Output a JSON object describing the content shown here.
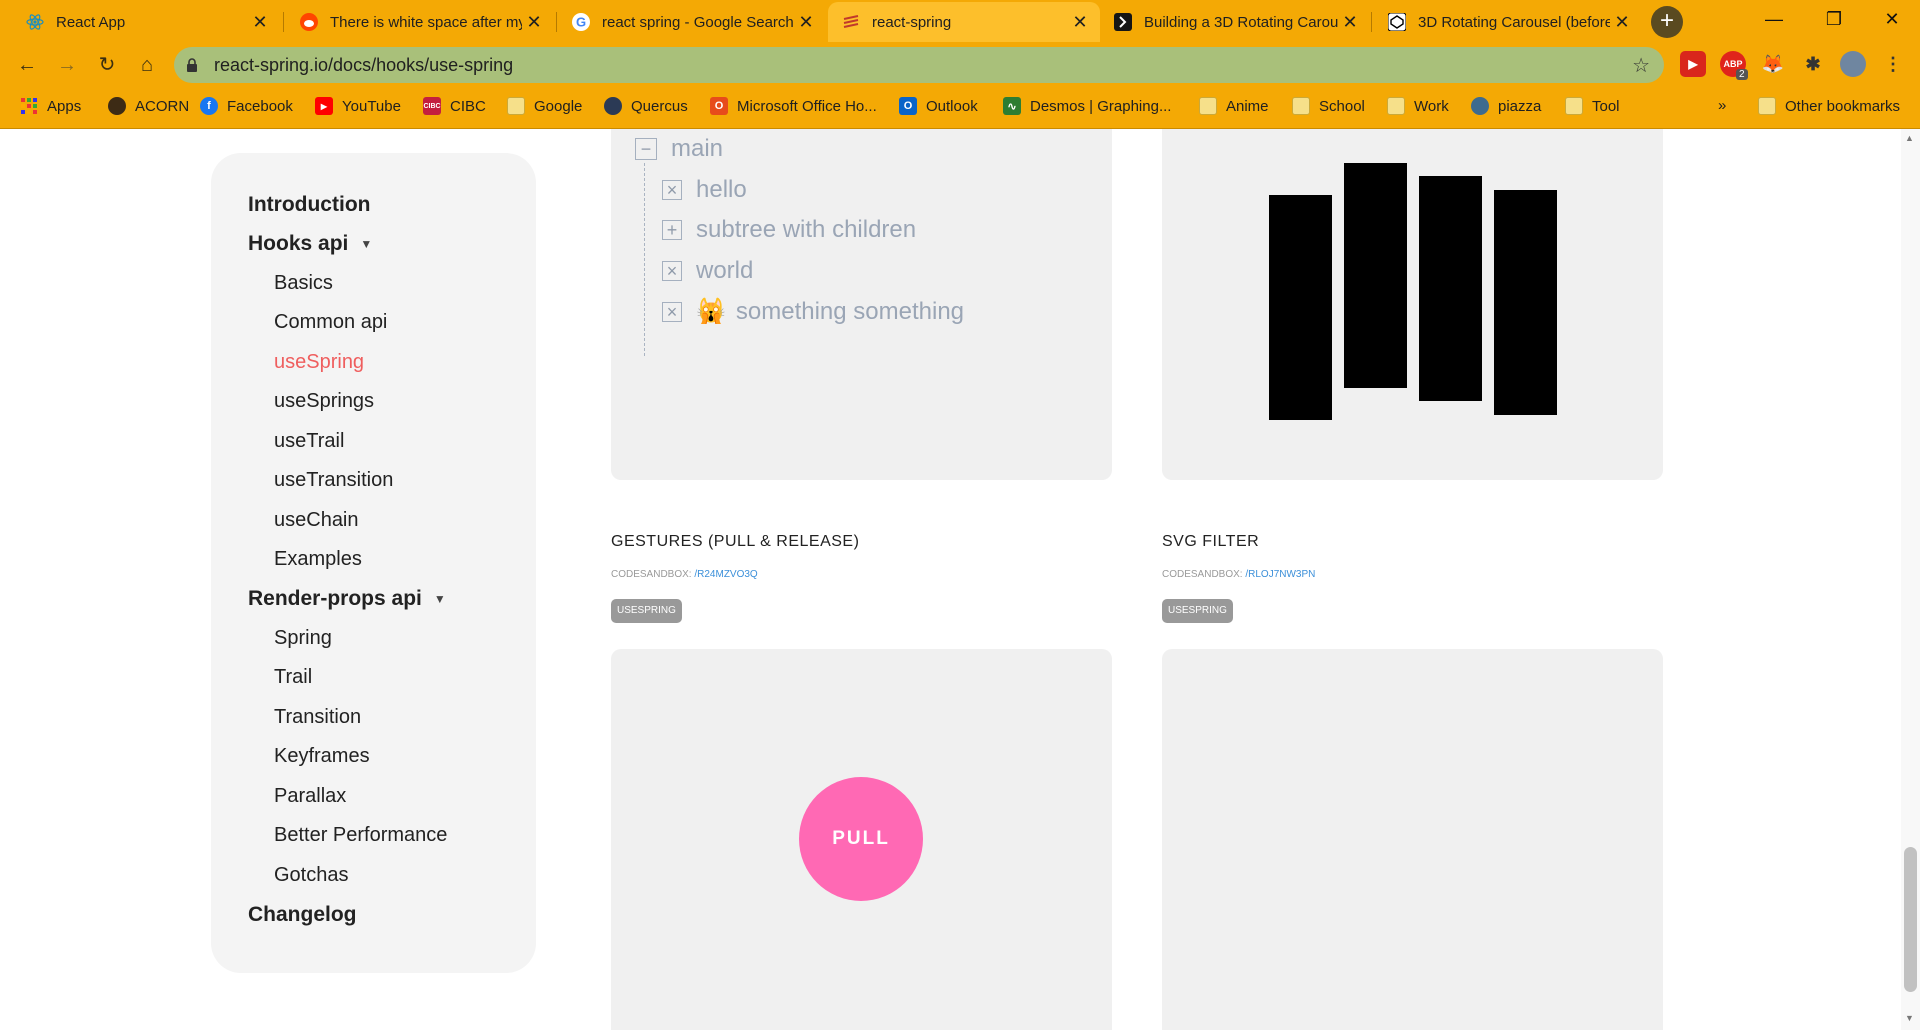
{
  "tabs": [
    {
      "title": "React App",
      "icon": "react-icon",
      "color": "#61dafb"
    },
    {
      "title": "There is white space after my",
      "icon": "reddit-icon",
      "color": "#ff4500"
    },
    {
      "title": "react spring - Google Search",
      "icon": "google-icon",
      "color": "#4285f4"
    },
    {
      "title": "react-spring",
      "icon": "react-spring-icon",
      "color": "#ef5e5e"
    },
    {
      "title": "Building a 3D Rotating Carou",
      "icon": "codesandbox-icon",
      "color": "#000000"
    },
    {
      "title": "3D Rotating Carousel (before",
      "icon": "codepen-icon",
      "color": "#000000"
    }
  ],
  "active_tab_index": 3,
  "address_bar": {
    "url": "react-spring.io/docs/hooks/use-spring"
  },
  "extensions": {
    "abp_badge": "2"
  },
  "bookmarks": [
    {
      "label": "Apps",
      "icon": "apps-grid-icon"
    },
    {
      "label": "ACORN",
      "icon": "acorn-icon"
    },
    {
      "label": "Facebook",
      "icon": "facebook-icon"
    },
    {
      "label": "YouTube",
      "icon": "youtube-icon"
    },
    {
      "label": "CIBC",
      "icon": "cibc-icon"
    },
    {
      "label": "Google",
      "icon": "folder-icon"
    },
    {
      "label": "Quercus",
      "icon": "quercus-icon"
    },
    {
      "label": "Microsoft Office Ho...",
      "icon": "office-icon"
    },
    {
      "label": "Outlook",
      "icon": "outlook-icon"
    },
    {
      "label": "Desmos | Graphing...",
      "icon": "desmos-icon"
    },
    {
      "label": "Anime",
      "icon": "folder-icon"
    },
    {
      "label": "School",
      "icon": "folder-icon"
    },
    {
      "label": "Work",
      "icon": "folder-icon"
    },
    {
      "label": "piazza",
      "icon": "piazza-icon"
    },
    {
      "label": "Tool",
      "icon": "folder-icon"
    }
  ],
  "other_bookmarks": "Other bookmarks",
  "overflow_chevron": "»",
  "sidebar": {
    "introduction": "Introduction",
    "hooks_api": "Hooks api",
    "hooks_items": [
      "Basics",
      "Common api",
      "useSpring",
      "useSprings",
      "useTrail",
      "useTransition",
      "useChain",
      "Examples"
    ],
    "render_props_api": "Render-props api",
    "render_props_items": [
      "Spring",
      "Trail",
      "Transition",
      "Keyframes",
      "Parallax",
      "Better Performance",
      "Gotchas"
    ],
    "changelog": "Changelog",
    "active_item": "useSpring"
  },
  "tree": {
    "root": "main",
    "children": [
      "hello",
      "subtree with children",
      "world",
      "something something"
    ],
    "emoji": "🙀"
  },
  "sections": [
    {
      "title": "GESTURES (PULL & RELEASE)",
      "codesandbox_prefix": "CODESANDBOX:",
      "codesandbox_link": "/R24MZVO3Q",
      "tag": "USESPRING"
    },
    {
      "title": "SVG FILTER",
      "codesandbox_prefix": "CODESANDBOX:",
      "codesandbox_link": "/RLOJ7NW3PN",
      "tag": "USESPRING"
    }
  ],
  "pull_button": "PULL",
  "colors": {
    "chrome": "#f4a905",
    "active_nav": "#ef5e5e",
    "pull": "#ff69b4"
  }
}
